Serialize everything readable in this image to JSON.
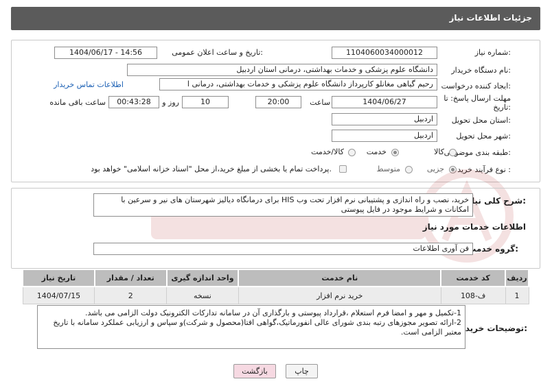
{
  "header": {
    "title": "جزئیات اطلاعات نیاز"
  },
  "form": {
    "need_number_label": "شماره نیاز:",
    "need_number": "1104060034000012",
    "announce_label": "تاریخ و ساعت اعلان عمومی:",
    "announce_value": "1404/06/17 - 14:56",
    "buyer_org_label": "نام دستگاه خریدار:",
    "buyer_org": "دانشگاه علوم پزشکی و خدمات بهداشتی، درمانی استان اردبیل",
    "creator_label": "ایجاد کننده درخواست:",
    "creator": "رحیم گیاهی مغانلو کارپرداز دانشگاه علوم پزشکی و خدمات بهداشتی، درمانی ا",
    "contact_link": "اطلاعات تماس خریدار",
    "deadline_label_1": "مهلت ارسال پاسخ: تا",
    "deadline_label_2": "تاریخ:",
    "deadline_date": "1404/06/27",
    "time_label": "ساعت",
    "deadline_time": "20:00",
    "days_value": "10",
    "days_label": "روز و",
    "remaining_value": "00:43:28",
    "remaining_label": "ساعت باقی مانده",
    "province_label": "استان محل تحویل:",
    "province": "اردبیل",
    "city_label": "شهر محل تحویل:",
    "city": "اردبیل",
    "category_label": "طبقه بندی موضوعی:",
    "category_options": [
      "کالا",
      "خدمت",
      "کالا/خدمت"
    ],
    "category_selected": "خدمت",
    "process_label": "نوع فرآیند خرید :",
    "process_options": [
      "جزیی",
      "متوسط"
    ],
    "process_selected": "جزیی",
    "payment_note": "پرداخت تمام یا بخشی از مبلغ خرید،از محل \"اسناد خزانه اسلامی\" خواهد بود."
  },
  "description": {
    "label": "شرح کلی نیاز:",
    "text": "خرید، نصب و راه اندازی و پشتیبانی نرم افزار تحت وب HIS برای درمانگاه دیالیز شهرستان های نیر و سرعین با امکانات و شرایط موجود در فایل پیوستی"
  },
  "services": {
    "section_title": "اطلاعات خدمات مورد نیاز",
    "group_label": "گروه خدمت:",
    "group_value": "فن آوری اطلاعات",
    "columns": [
      "ردیف",
      "کد خدمت",
      "نام خدمت",
      "واحد اندازه گیری",
      "تعداد / مقدار",
      "تاریخ نیاز"
    ],
    "rows": [
      [
        "1",
        "ف-108",
        "خرید نرم افزار",
        "نسخه",
        "2",
        "1404/07/15"
      ]
    ]
  },
  "buyer_notes": {
    "label": "توضیحات خریدار:",
    "line1": "1-تکمیل و مهر و امضا فرم استعلام ،قرارداد پیوستی و بارگذاری آن در سامانه تدارکات الکترونیک دولت الزامی می باشد.",
    "line2": "2-ارائه تصویر مجوزهای رتبه بندی شورای عالی انفورماتیک،گواهی افتا(محصول و شرکت)و سپاس و ارزیابی عملکرد سامانه با تاریخ معتبر الزامی است."
  },
  "buttons": {
    "print": "چاپ",
    "back": "بازگشت"
  },
  "colors": {
    "titlebar": "#5b5b5b",
    "link": "#1a5fb4",
    "back_button": "#f6d9e2",
    "table_header": "#bdbdbd",
    "watermark": "#b22222"
  }
}
